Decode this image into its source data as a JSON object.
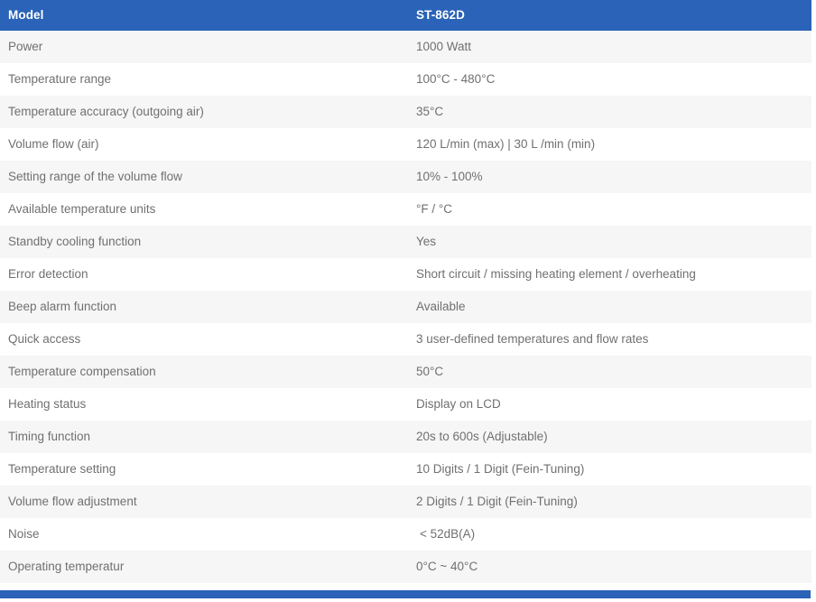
{
  "table": {
    "header": {
      "label": "Model",
      "value": "ST-862D"
    },
    "colors": {
      "header_bg": "#2a63b7",
      "footer_bar": "#2a63b7",
      "row_odd_bg": "#f6f6f6",
      "row_even_bg": "#ffffff",
      "text": "#707070",
      "header_text": "#ffffff"
    },
    "rows": [
      {
        "label": "Power",
        "value": "1000 Watt"
      },
      {
        "label": "Temperature range",
        "value": "100°C - 480°C"
      },
      {
        "label": "Temperature accuracy (outgoing air)",
        "value": "35°C"
      },
      {
        "label": "Volume flow (air)",
        "value": "120 L/min (max) | 30 L /min (min)"
      },
      {
        "label": "Setting range of the volume flow",
        "value": "10% - 100%"
      },
      {
        "label": "Available temperature units",
        "value": "°F / °C"
      },
      {
        "label": "Standby cooling function",
        "value": "Yes"
      },
      {
        "label": "Error detection",
        "value": "Short circuit / missing heating element / overheating"
      },
      {
        "label": "Beep alarm function",
        "value": "Available"
      },
      {
        "label": "Quick access",
        "value": "3 user-defined temperatures and flow rates"
      },
      {
        "label": "Temperature compensation",
        "value": "50°C"
      },
      {
        "label": "Heating status",
        "value": "Display on LCD"
      },
      {
        "label": "Timing function",
        "value": "20s to 600s (Adjustable)"
      },
      {
        "label": "Temperature setting",
        "value": "10 Digits / 1 Digit (Fein-Tuning)"
      },
      {
        "label": "Volume flow adjustment",
        "value": "2 Digits / 1 Digit (Fein-Tuning)"
      },
      {
        "label": "Noise",
        "value": "< 52dB(A)"
      },
      {
        "label": "Operating temperatur",
        "value": "0°C ~ 40°C"
      }
    ]
  }
}
